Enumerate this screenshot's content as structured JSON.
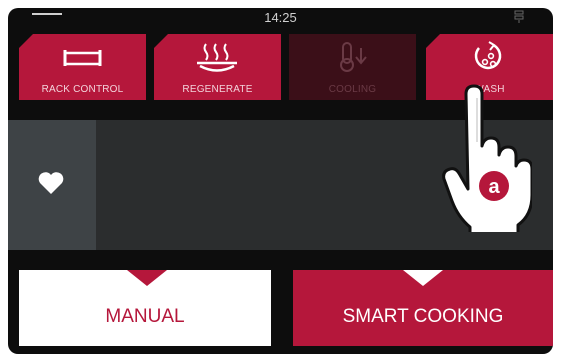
{
  "status": {
    "time": "14:25"
  },
  "functions": [
    {
      "label": "RACK CONTROL",
      "icon": "rack-icon",
      "enabled": true
    },
    {
      "label": "REGENERATE",
      "icon": "regenerate-icon",
      "enabled": true
    },
    {
      "label": "COOLING",
      "icon": "thermometer-down-icon",
      "enabled": false
    },
    {
      "label": "WASH",
      "icon": "wash-icon",
      "enabled": true
    }
  ],
  "favorites": {
    "icon": "heart-icon"
  },
  "modes": {
    "manual": "MANUAL",
    "smart": "SMART COOKING"
  },
  "callout": {
    "letter": "a",
    "icon": "pointing-hand-icon"
  },
  "colors": {
    "accent": "#b5173b",
    "background": "#0d0d0d",
    "panel": "#2b2d2e",
    "favorites_bg": "#3e4346"
  }
}
